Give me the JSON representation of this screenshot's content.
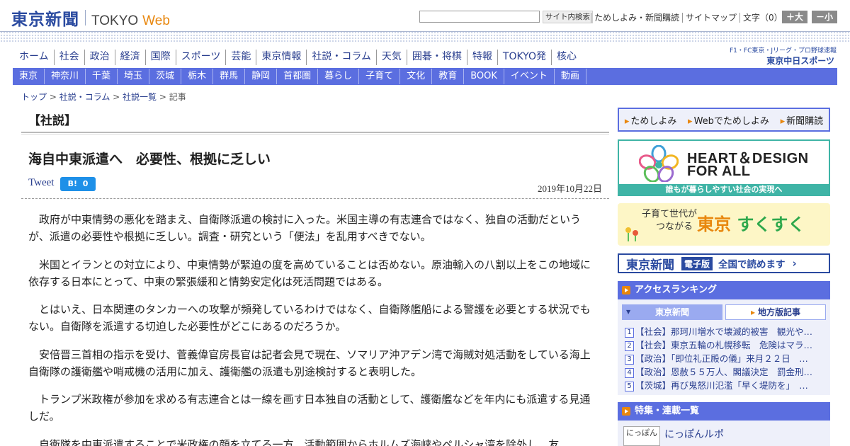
{
  "header": {
    "logo_jp": "東京新聞",
    "logo_en": "TOKYO",
    "logo_web": "Web",
    "search_placeholder": "",
    "search_button": "サイト内検索",
    "links": [
      "ためしよみ・新聞購読",
      "サイトマップ"
    ],
    "font_size_label": "文字（0）",
    "font_larger": "＋大",
    "font_smaller": "－小"
  },
  "nav_main": [
    "ホーム",
    "社会",
    "政治",
    "経済",
    "国際",
    "スポーツ",
    "芸能",
    "東京情報",
    "社説・コラム",
    "天気",
    "囲碁・将棋",
    "特報",
    "TOKYO発",
    "核心"
  ],
  "sports_logo": {
    "line1": "F1・FC東京・Jリーグ・プロ野球速報",
    "line2": "東京中日スポーツ"
  },
  "nav_region": [
    "東京",
    "神奈川",
    "千葉",
    "埼玉",
    "茨城",
    "栃木",
    "群馬",
    "静岡",
    "首都圏",
    "暮らし",
    "子育て",
    "文化",
    "教育",
    "BOOK",
    "イベント",
    "動画"
  ],
  "breadcrumb": {
    "items": [
      "トップ",
      "社説・コラム",
      "社説一覧"
    ],
    "current": "記事",
    "sep": " > "
  },
  "article": {
    "section": "【社説】",
    "title": "海自中東派遣へ　必要性、根拠に乏しい",
    "tweet": "Tweet",
    "hatena_label": "B!",
    "hatena_count": "0",
    "date": "2019年10月22日",
    "paragraphs": [
      "政府が中東情勢の悪化を踏まえ、自衛隊派遣の検討に入った。米国主導の有志連合ではなく、独自の活動だというが、派遣の必要性や根拠に乏しい。調査・研究という「便法」を乱用すべきでない。",
      "米国とイランとの対立により、中東情勢が緊迫の度を高めていることは否めない。原油輸入の八割以上をこの地域に依存する日本にとって、中東の緊張緩和と情勢安定化は死活問題ではある。",
      "とはいえ、日本関連のタンカーへの攻撃が頻発しているわけではなく、自衛隊艦船による警護を必要とする状況でもない。自衛隊を派遣する切迫した必要性がどこにあるのだろうか。",
      "安倍晋三首相の指示を受け、菅義偉官房長官は記者会見で現在、ソマリア沖アデン湾で海賊対処活動をしている海上自衛隊の護衛艦や哨戒機の活用に加え、護衛艦の派遣も別途検討すると表明した。",
      "トランプ米政権が参加を求める有志連合とは一線を画す日本独自の活動として、護衛艦などを年内にも派遣する見通しだ。",
      "自衛隊を中東派遣することで米政権の顔を立てる一方、活動範囲からホルムズ海峡やペルシャ湾を除外し、友"
    ]
  },
  "sidebar": {
    "subscribe_links": [
      "ためしよみ",
      "Webでためしよみ",
      "新聞購読"
    ],
    "hd_banner": {
      "line1": "HEART＆DESIGN",
      "line2": "FOR ALL",
      "caption": "誰もが暮らしやすい社会の実現へ"
    },
    "sukusuku": {
      "sub1": "子育て世代が",
      "sub2": "つながる",
      "main1": "東京",
      "main2": "すくすく"
    },
    "epaper": {
      "logo": "東京新聞",
      "tag": "電子版",
      "text": "全国で読めます",
      "arrow": "›"
    },
    "ranking": {
      "heading": "アクセスランキング",
      "tab_active": "東京新聞",
      "tab_other": "地方版記事",
      "items": [
        {
          "num": "1",
          "text": "【社会】那珂川増水で壊滅的被害　観光や…"
        },
        {
          "num": "2",
          "text": "【社会】東京五輪の札幌移転　危険はマラ…"
        },
        {
          "num": "3",
          "text": "【政治】「即位礼正殿の儀」来月２２日　…"
        },
        {
          "num": "4",
          "text": "【政治】恩赦５５万人、閣議決定　罰金刑…"
        },
        {
          "num": "5",
          "text": "【茨城】再び鬼怒川氾濫「早く堤防を」　…"
        }
      ]
    },
    "features": {
      "heading": "特集・連載一覧",
      "thumb": "にっぽん",
      "first_title": "にっぽんルポ"
    }
  }
}
